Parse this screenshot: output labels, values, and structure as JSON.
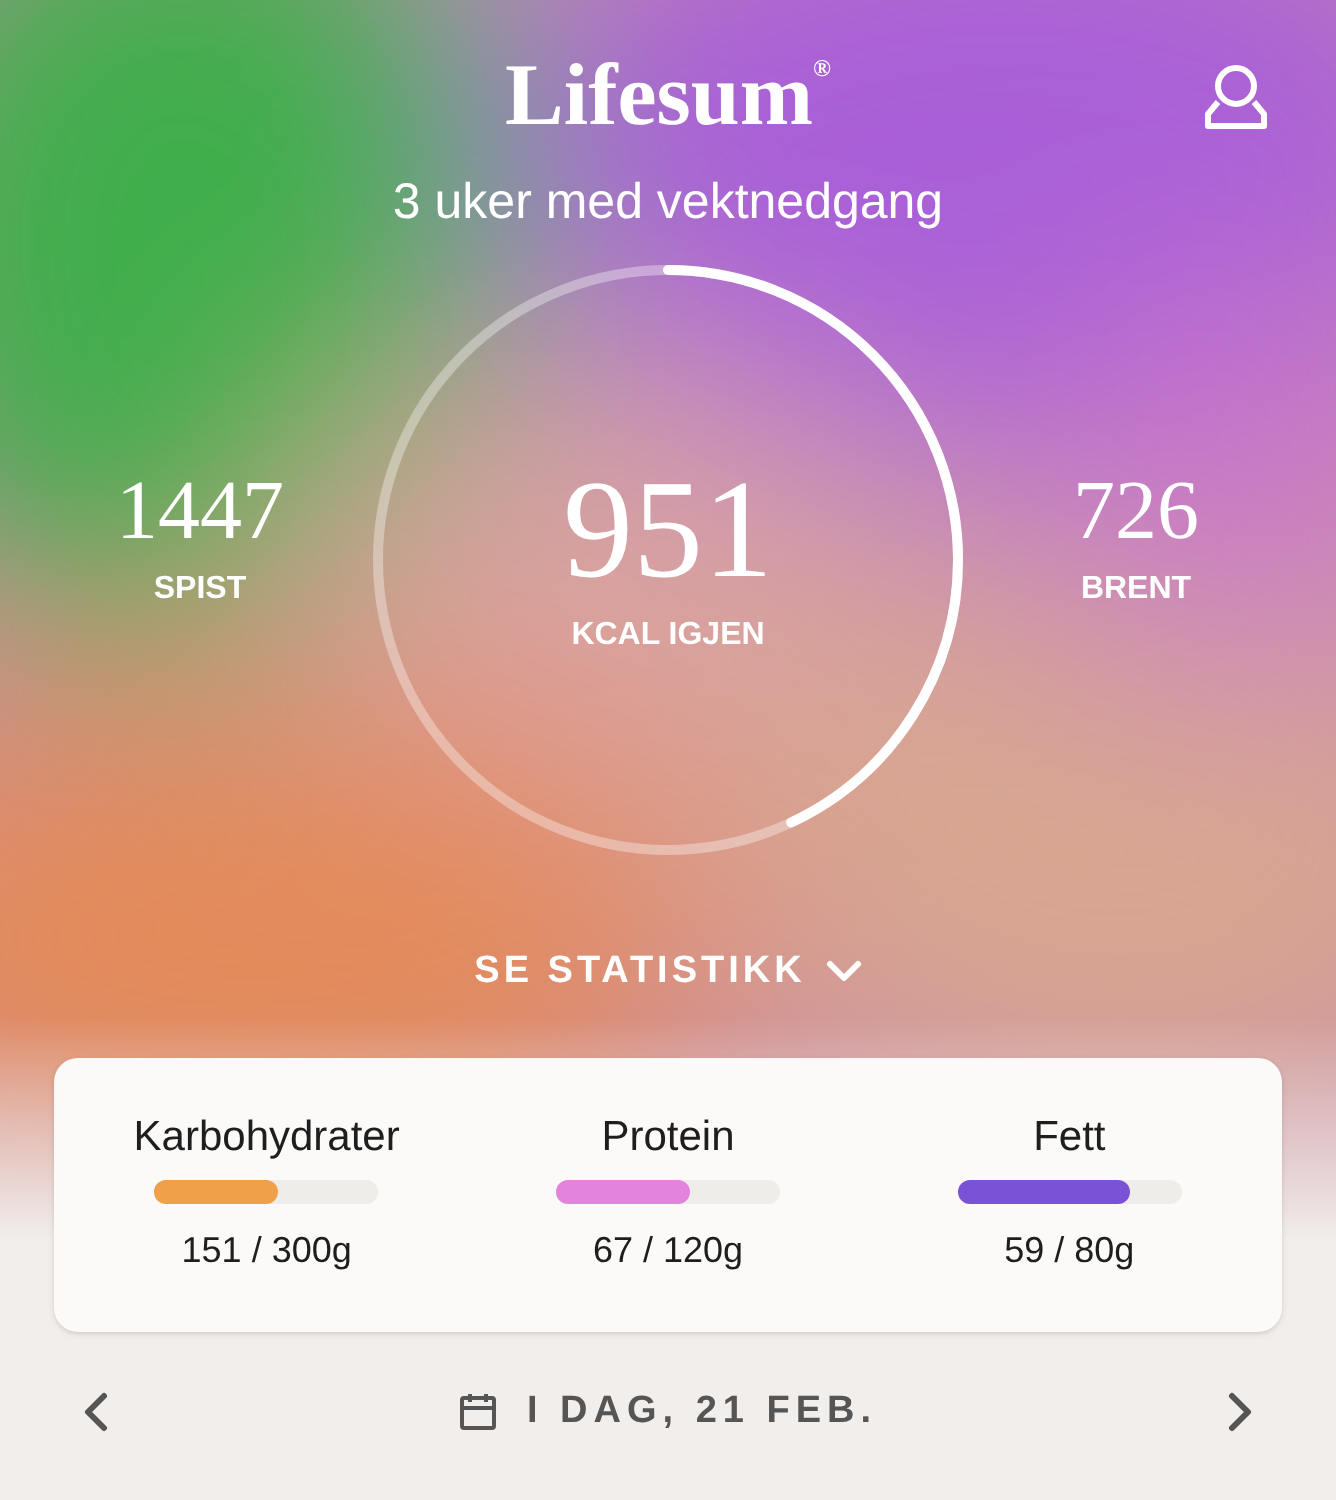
{
  "header": {
    "logo": "Lifesum",
    "registered": "®",
    "subtitle": "3 uker med vektnedgang"
  },
  "summary": {
    "eaten": {
      "value": "1447",
      "label": "SPIST"
    },
    "remaining": {
      "value": "951",
      "label": "KCAL IGJEN",
      "level": 0.43
    },
    "burned": {
      "value": "726",
      "label": "BRENT"
    }
  },
  "stats_toggle": "SE STATISTIKK",
  "macros": [
    {
      "name": "Karbohydrater",
      "amount": "151 / 300g",
      "level": 0.55,
      "color": "#f0a049"
    },
    {
      "name": "Protein",
      "amount": "67 / 120g",
      "level": 0.6,
      "color": "#e483de"
    },
    {
      "name": "Fett",
      "amount": "59 / 80g",
      "level": 0.77,
      "color": "#7a52d6"
    }
  ],
  "date_nav": {
    "label": "I DAG, 21 FEB."
  }
}
